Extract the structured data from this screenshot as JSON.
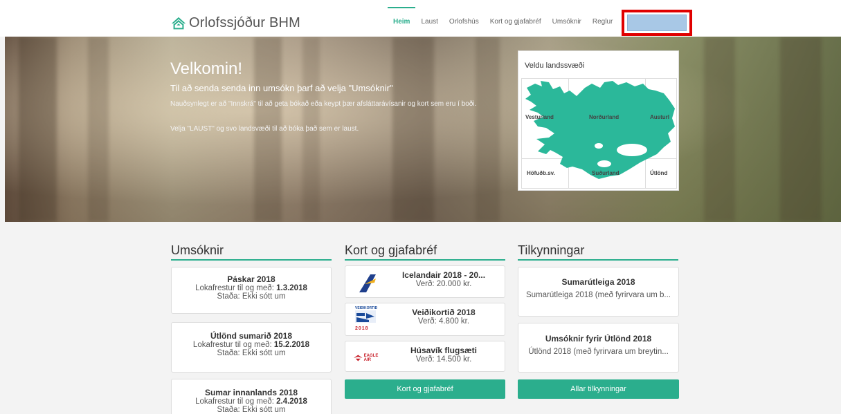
{
  "brand": {
    "name": "Orlofssjóður BHM",
    "accent": "#2bae8d"
  },
  "nav": {
    "items": [
      {
        "label": "Heim",
        "active": true
      },
      {
        "label": "Laust",
        "active": false
      },
      {
        "label": "Orlofshús",
        "active": false
      },
      {
        "label": "Kort og gjafabréf",
        "active": false
      },
      {
        "label": "Umsóknir",
        "active": false
      },
      {
        "label": "Reglur",
        "active": false
      }
    ]
  },
  "hero": {
    "title": "Velkomin!",
    "subtitle": "Til að senda senda inn umsókn þarf að velja \"Umsóknir\"",
    "paragraph1": "Nauðsynlegt er að \"Innskrá\" til að geta bókað eða keypt þær afsláttarávísanir  og kort sem eru í boði.",
    "paragraph2": "Velja \"LAUST\" og svo landsvæði til að bóka það sem er laust."
  },
  "map": {
    "title": "Veldu landssvæði",
    "regions": {
      "vesturland": "Vesturland",
      "nordurland": "Norðurland",
      "austurland": "Austurl",
      "hofudb": "Höfuðb.sv.",
      "sudurland": "Suðurland",
      "utlond": "Útlönd"
    }
  },
  "umsoknir": {
    "heading": "Umsóknir",
    "items": [
      {
        "title": "Páskar 2018",
        "deadline_label": "Lokafrestur til og með: ",
        "deadline": "1.3.2018",
        "status": "Staða: Ekki sótt um"
      },
      {
        "title": "Útlönd sumarið 2018",
        "deadline_label": "Lokafrestur til og með: ",
        "deadline": "15.2.2018",
        "status": "Staða: Ekki sótt um"
      },
      {
        "title": "Sumar innanlands 2018",
        "deadline_label": "Lokafrestur til og með: ",
        "deadline": "2.4.2018",
        "status": "Staða: Ekki sótt um"
      }
    ]
  },
  "kort": {
    "heading": "Kort og gjafabréf",
    "items": [
      {
        "title": "Icelandair 2018 - 20...",
        "price": "Verð: 20.000 kr.",
        "logo": "icelandair-logo"
      },
      {
        "title": "Veiðikortið 2018",
        "price": "Verð: 4.800 kr.",
        "logo": "veidikortid-logo",
        "logo_text_top": "VEIÐIKORTIÐ",
        "logo_text_bottom": "2018"
      },
      {
        "title": "Húsavík flugsæti",
        "price": "Verð: 14.500 kr.",
        "logo": "eagle-air-logo",
        "logo_text": "EAGLE AIR"
      }
    ],
    "button": "Kort og gjafabréf"
  },
  "tilkynningar": {
    "heading": "Tilkynningar",
    "items": [
      {
        "title": "Sumarútleiga 2018",
        "text": "Sumarútleiga 2018 (með fyrirvara um b..."
      },
      {
        "title": "Umsóknir fyrir Útlönd 2018",
        "text": "Útlönd 2018 (með fyrirvara um breytin..."
      }
    ],
    "button": "Allar tilkynningar"
  }
}
